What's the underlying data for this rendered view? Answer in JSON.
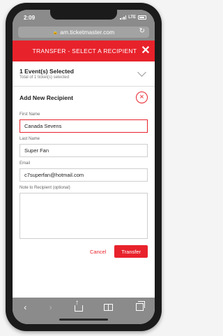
{
  "status_bar": {
    "time": "2:09",
    "network": "LTE"
  },
  "browser": {
    "url": "am.ticketmaster.com"
  },
  "header": {
    "title": "TRANSFER - SELECT A RECIPIENT",
    "close_label": "✕"
  },
  "events": {
    "title": "1 Event(s) Selected",
    "subtitle": "Total of 1 ticket(s) selected"
  },
  "recipient": {
    "title": "Add New Recipient",
    "remove_label": "×",
    "first_name": {
      "label": "First Name",
      "value": "Canada Sevens"
    },
    "last_name": {
      "label": "Last Name",
      "value": "Super Fan"
    },
    "email": {
      "label": "Email",
      "value": "c7superfan@hotmail.com"
    },
    "note": {
      "label": "Note to Recipient (optional)",
      "value": ""
    }
  },
  "actions": {
    "cancel_label": "Cancel",
    "transfer_label": "Transfer"
  },
  "toolbar": {
    "back": "‹",
    "forward": "›"
  },
  "colors": {
    "accent": "#e8222b",
    "chrome": "#8b8b8b"
  }
}
